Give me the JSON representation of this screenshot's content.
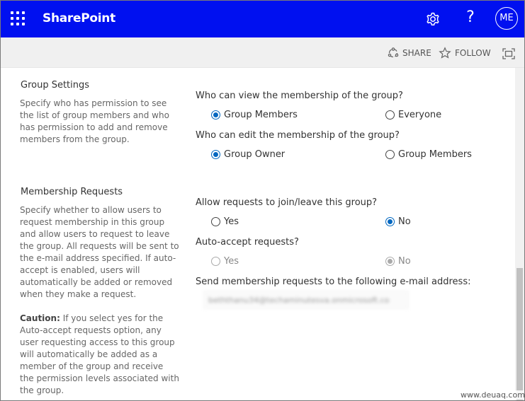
{
  "suitebar": {
    "brand": "SharePoint",
    "help_label": "?",
    "avatar_initials": "ME",
    "background_color": "#0010f0"
  },
  "commandbar": {
    "share_label": "SHARE",
    "follow_label": "FOLLOW"
  },
  "sections": {
    "group_settings": {
      "title": "Group Settings",
      "description": "Specify who has permission to see the list of group members and who has permission to add and remove members from the group.",
      "view_question": "Who can view the membership of the group?",
      "view_options": [
        "Group Members",
        "Everyone"
      ],
      "view_selected": "Group Members",
      "edit_question": "Who can edit the membership of the group?",
      "edit_options": [
        "Group Owner",
        "Group Members"
      ],
      "edit_selected": "Group Owner"
    },
    "membership_requests": {
      "title": "Membership Requests",
      "description": "Specify whether to allow users to request membership in this group and allow users to request to leave the group. All requests will be sent to the e-mail address specified. If auto-accept is enabled, users will automatically be added or removed when they make a request.",
      "caution_label": "Caution:",
      "caution_text": " If you select yes for the Auto-accept requests option, any user requesting access to this group will automatically be added as a member of the group and receive the permission levels associated with the group.",
      "allow_question": "Allow requests to join/leave this group?",
      "allow_options": [
        "Yes",
        "No"
      ],
      "allow_selected": "No",
      "auto_question": "Auto-accept requests?",
      "auto_options": [
        "Yes",
        "No"
      ],
      "auto_selected": "No",
      "email_question": "Send membership requests to the following e-mail address:",
      "email_value": "beththanu34@techaminutesva.onmicrosoft.co"
    }
  },
  "watermark": "www.deuaq.com"
}
